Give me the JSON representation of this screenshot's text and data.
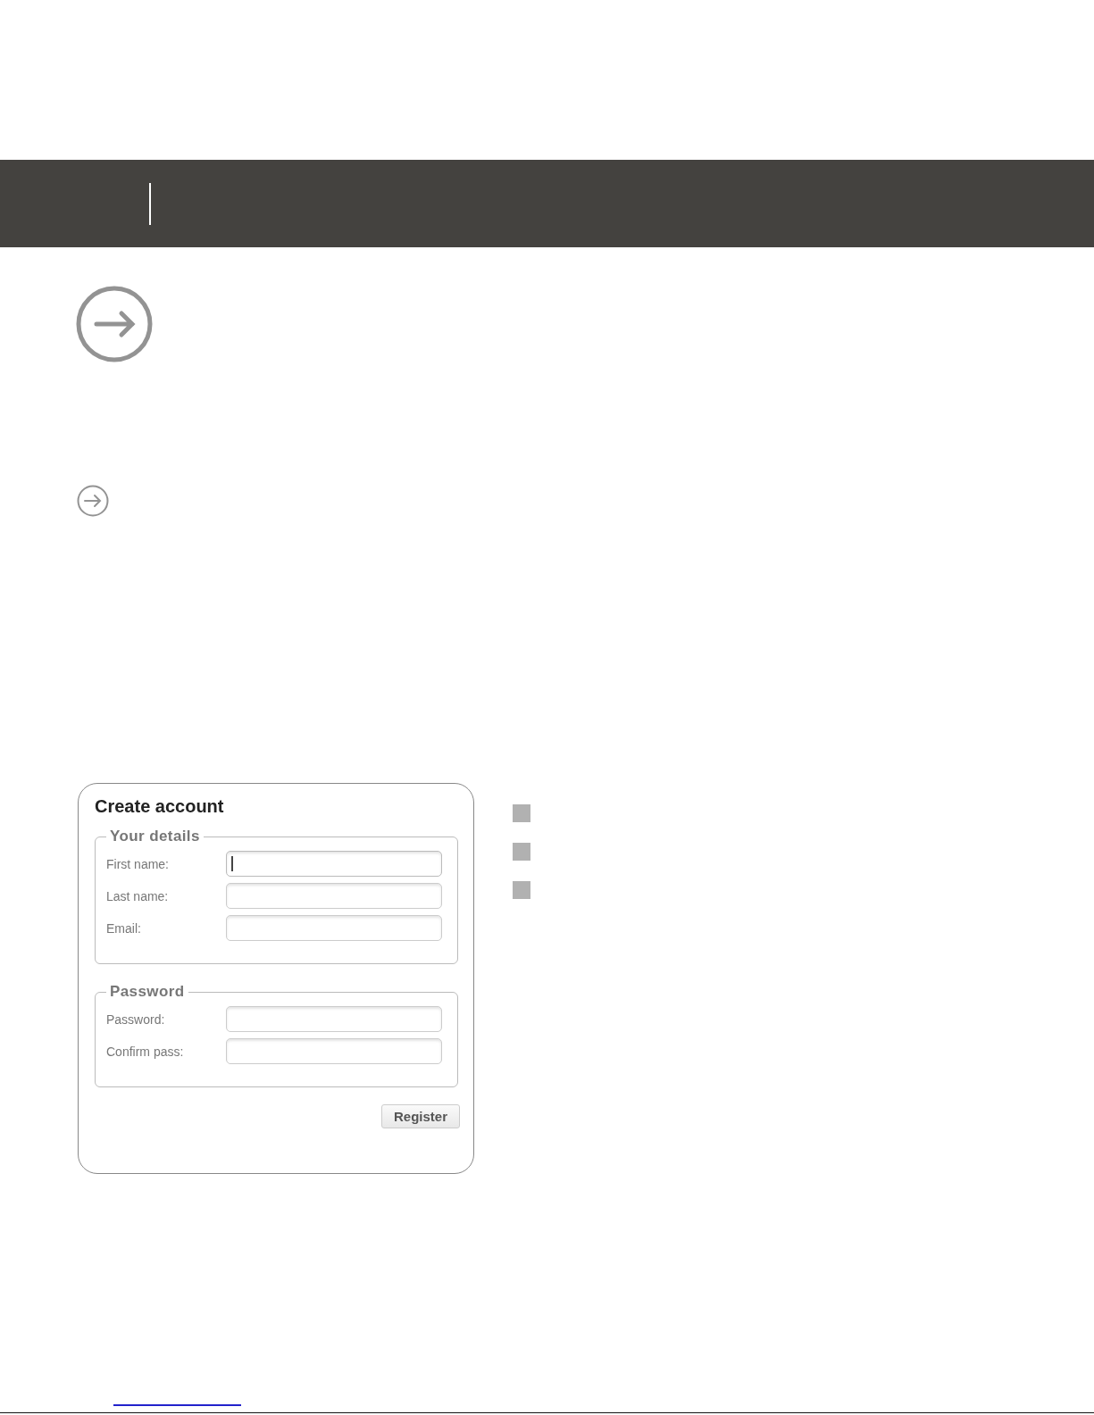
{
  "form": {
    "title": "Create account",
    "sections": [
      {
        "legend": "Your details",
        "fields": [
          {
            "label": "First name:",
            "focused": true
          },
          {
            "label": "Last name:",
            "focused": false
          },
          {
            "label": "Email:",
            "focused": false
          }
        ]
      },
      {
        "legend": "Password",
        "fields": [
          {
            "label": "Password:",
            "focused": false
          },
          {
            "label": "Confirm pass:",
            "focused": false
          }
        ]
      }
    ],
    "button": "Register"
  }
}
